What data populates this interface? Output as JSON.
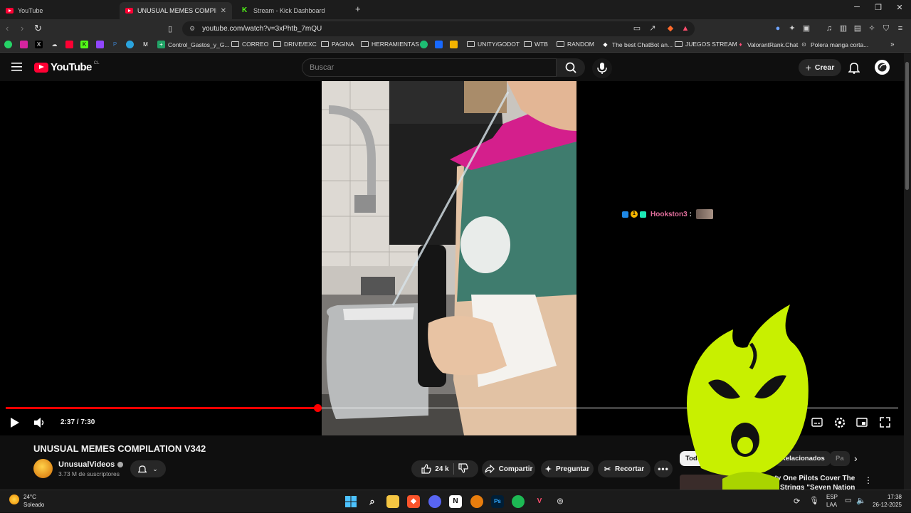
{
  "browser": {
    "tabs": [
      {
        "label": "YouTube",
        "icon": "youtube-icon"
      },
      {
        "label": "UNUSUAL MEMES COMPILATION",
        "icon": "youtube-icon"
      },
      {
        "label": "Stream - Kick Dashboard",
        "icon": "kick-icon"
      }
    ],
    "address": "youtube.com/watch?v=3xPhtb_7mQU",
    "bookmarks": [
      "Control_Gastos_y_G...",
      "CORREO",
      "DRIVE/EXC",
      "PAGINA",
      "HERRAMIENTAS",
      "UNITY/GODOT",
      "WTB",
      "RANDOM",
      "The best ChatBot an...",
      "JUEGOS STREAM",
      "ValorantRank.Chat",
      "Polera manga corta..."
    ]
  },
  "youtube": {
    "logo_text": "YouTube",
    "logo_country": "CL",
    "search_placeholder": "Buscar",
    "create_label": "Crear"
  },
  "player": {
    "time": "2:37 / 7:30",
    "progress_fraction": 0.349
  },
  "chat": {
    "username": "Hookston3",
    "separator": ":",
    "badge_number": "1"
  },
  "video": {
    "title": "UNUSUAL MEMES COMPILATION V342",
    "channel": "UnusualVideos",
    "subscribers": "3.73 M de suscriptores",
    "likes": "24 k",
    "share_label": "Compartir",
    "ask_label": "Preguntar",
    "clip_label": "Recortar"
  },
  "sidebar_chips": [
    "Todos",
    "Relacionados",
    "Pa"
  ],
  "recommended": {
    "title_partial": "wenty One Pilots Cover The",
    "subtitle_partial": "Strings \"Seven Nation"
  },
  "taskbar": {
    "weather_temp": "24°C",
    "weather_desc": "Soleado",
    "lang_top": "ESP",
    "lang_bottom": "LAA",
    "time": "17:38",
    "date": "26-12-2025"
  },
  "colors": {
    "accent_red": "#ff0033",
    "kick_green": "#53fc18",
    "mascot_green": "#c8f000",
    "chat_name": "#e4709e"
  }
}
